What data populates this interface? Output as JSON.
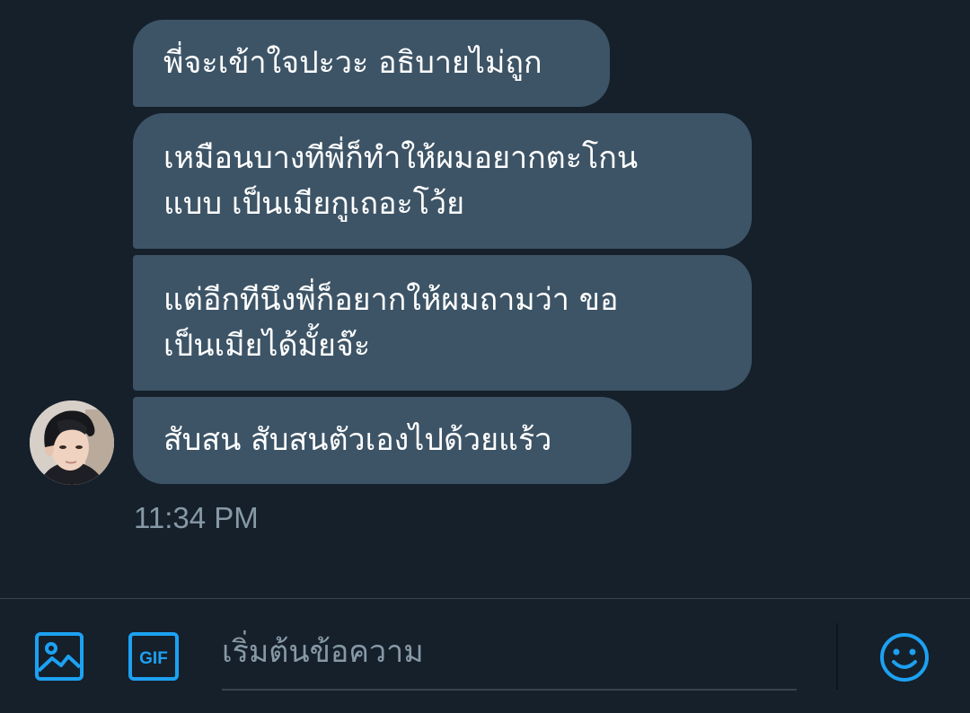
{
  "conversation": {
    "messages": [
      {
        "lines": [
          "พี่จะเข้าใจปะวะ อธิบายไม่ถูก"
        ]
      },
      {
        "lines": [
          "เหมือนบางทีพี่ก็ทำให้ผมอยากตะโกน",
          "แบบ เป็นเมียกูเถอะโว้ย"
        ]
      },
      {
        "lines": [
          "แต่อีกทีนึงพี่ก็อยากให้ผมถามว่า ขอ",
          "เป็นเมียได้มั้ยจ๊ะ"
        ]
      },
      {
        "lines": [
          "สับสน สับสนตัวเองไปด้วยแร้ว"
        ]
      }
    ],
    "timestamp": "11:34 PM"
  },
  "composer": {
    "placeholder": "เริ่มต้นข้อความ",
    "gif_label": "GIF",
    "icons": {
      "image": "image-icon",
      "gif": "gif-icon",
      "emoji": "emoji-icon"
    }
  },
  "colors": {
    "background": "#15202b",
    "bubble": "#3d5466",
    "accent": "#1da1f2",
    "muted_text": "#8899a6",
    "border": "#38444d"
  }
}
